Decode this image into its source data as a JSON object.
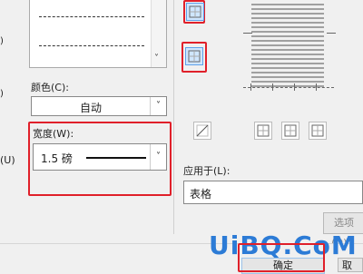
{
  "left": {
    "underline_hint": "(U)"
  },
  "style_list": {
    "aria": "line style list"
  },
  "color": {
    "label": "颜色(C):",
    "value": "自动"
  },
  "width": {
    "label": "宽度(W):",
    "value": "1.5 磅"
  },
  "apply_to": {
    "label": "应用于(L):",
    "value": "表格"
  },
  "buttons": {
    "options": "选项(O)...",
    "ok": "确定",
    "cancel": "取"
  },
  "watermark": {
    "text": "UiBQ.CoM"
  },
  "colors": {
    "highlight": "#e0202a",
    "selected_icon_bg": "#cfe6ff",
    "watermark": "#2c7bd6"
  }
}
